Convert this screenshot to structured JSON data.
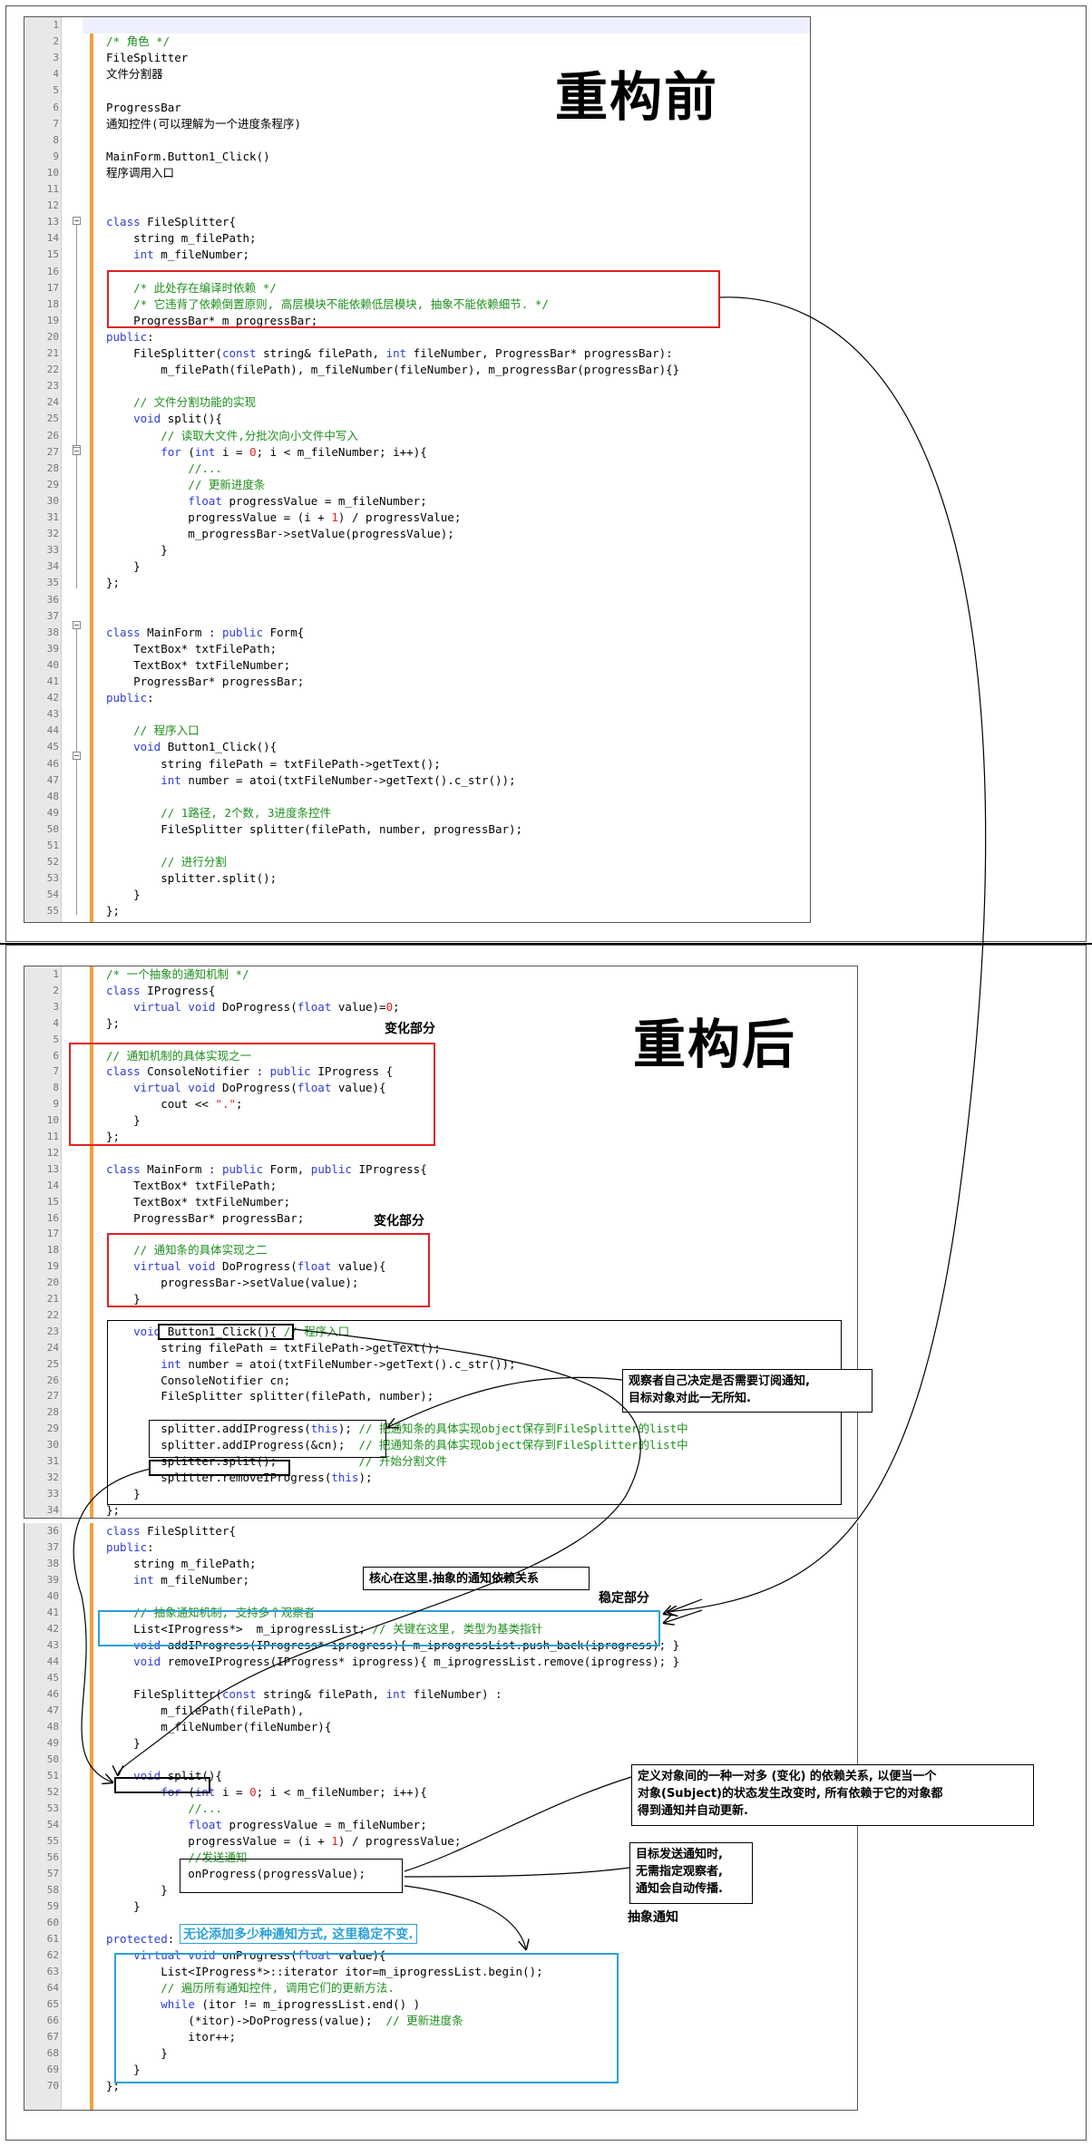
{
  "before": {
    "title": "重构前",
    "lines": [
      {
        "n": "1",
        "t": ""
      },
      {
        "n": "2",
        "t": "<span class=\"cm\">/* 角色 */</span>"
      },
      {
        "n": "3",
        "t": "FileSplitter"
      },
      {
        "n": "4",
        "t": "文件分割器"
      },
      {
        "n": "5",
        "t": ""
      },
      {
        "n": "6",
        "t": "ProgressBar"
      },
      {
        "n": "7",
        "t": "通知控件(可以理解为一个进度条程序)"
      },
      {
        "n": "8",
        "t": ""
      },
      {
        "n": "9",
        "t": "MainForm.Button1_Click()"
      },
      {
        "n": "10",
        "t": "程序调用入口"
      },
      {
        "n": "11",
        "t": ""
      },
      {
        "n": "12",
        "t": ""
      },
      {
        "n": "13",
        "t": "<span class=\"kw\">class</span> FileSplitter{"
      },
      {
        "n": "14",
        "t": "    string m_filePath;"
      },
      {
        "n": "15",
        "t": "    <span class=\"kw\">int</span> m_fileNumber;"
      },
      {
        "n": "16",
        "t": ""
      },
      {
        "n": "17",
        "t": "    <span class=\"cm\">/* 此处存在编译时依赖 */</span>"
      },
      {
        "n": "18",
        "t": "    <span class=\"cm\">/* 它违背了依赖倒置原则, 高层模块不能依赖低层模块, 抽象不能依赖细节. */</span>"
      },
      {
        "n": "19",
        "t": "    ProgressBar* m_progressBar;"
      },
      {
        "n": "20",
        "t": "<span class=\"kw\">public</span>:"
      },
      {
        "n": "21",
        "t": "    FileSplitter(<span class=\"kw\">const</span> string& filePath, <span class=\"kw\">int</span> fileNumber, ProgressBar* progressBar):"
      },
      {
        "n": "22",
        "t": "        m_filePath(filePath), m_fileNumber(fileNumber), m_progressBar(progressBar){}"
      },
      {
        "n": "23",
        "t": ""
      },
      {
        "n": "24",
        "t": "    <span class=\"cm\">// 文件分割功能的实现</span>"
      },
      {
        "n": "25",
        "t": "    <span class=\"kw\">void</span> split(){"
      },
      {
        "n": "26",
        "t": "        <span class=\"cm\">// 读取大文件,分批次向小文件中写入</span>"
      },
      {
        "n": "27",
        "t": "        <span class=\"kw\">for</span> (<span class=\"kw\">int</span> i = <span class=\"num\">0</span>; i < m_fileNumber; i++){"
      },
      {
        "n": "28",
        "t": "            <span class=\"cm\">//...</span>"
      },
      {
        "n": "29",
        "t": "            <span class=\"cm\">// 更新进度条</span>"
      },
      {
        "n": "30",
        "t": "            <span class=\"kw\">float</span> progressValue = m_fileNumber;"
      },
      {
        "n": "31",
        "t": "            progressValue = (i + <span class=\"num\">1</span>) / progressValue;"
      },
      {
        "n": "32",
        "t": "            m_progressBar->setValue(progressValue);"
      },
      {
        "n": "33",
        "t": "        }"
      },
      {
        "n": "34",
        "t": "    }"
      },
      {
        "n": "35",
        "t": "};"
      },
      {
        "n": "36",
        "t": ""
      },
      {
        "n": "37",
        "t": ""
      },
      {
        "n": "38",
        "t": "<span class=\"kw\">class</span> MainForm : <span class=\"kw\">public</span> Form{"
      },
      {
        "n": "39",
        "t": "    TextBox* txtFilePath;"
      },
      {
        "n": "40",
        "t": "    TextBox* txtFileNumber;"
      },
      {
        "n": "41",
        "t": "    ProgressBar* progressBar;"
      },
      {
        "n": "42",
        "t": "<span class=\"kw\">public</span>:"
      },
      {
        "n": "43",
        "t": ""
      },
      {
        "n": "44",
        "t": "    <span class=\"cm\">// 程序入口</span>"
      },
      {
        "n": "45",
        "t": "    <span class=\"kw\">void</span> Button1_Click(){"
      },
      {
        "n": "46",
        "t": "        string filePath = txtFilePath->getText();"
      },
      {
        "n": "47",
        "t": "        <span class=\"kw\">int</span> number = atoi(txtFileNumber->getText().c_str());"
      },
      {
        "n": "48",
        "t": ""
      },
      {
        "n": "49",
        "t": "        <span class=\"cm\">// 1路径, 2个数, 3进度条控件</span>"
      },
      {
        "n": "50",
        "t": "        FileSplitter splitter(filePath, number, progressBar);"
      },
      {
        "n": "51",
        "t": ""
      },
      {
        "n": "52",
        "t": "        <span class=\"cm\">// 进行分割</span>"
      },
      {
        "n": "53",
        "t": "        splitter.split();"
      },
      {
        "n": "54",
        "t": "    }"
      },
      {
        "n": "55",
        "t": "};"
      }
    ]
  },
  "after": {
    "title": "重构后",
    "lines1": [
      {
        "n": "1",
        "t": "<span class=\"cm\">/* 一个抽象的通知机制 */</span>"
      },
      {
        "n": "2",
        "t": "<span class=\"kw\">class</span> IProgress{"
      },
      {
        "n": "3",
        "t": "    <span class=\"kw\">virtual void</span> DoProgress(<span class=\"kw\">float</span> value)=<span class=\"num\">0</span>;"
      },
      {
        "n": "4",
        "t": "};"
      },
      {
        "n": "5",
        "t": ""
      },
      {
        "n": "6",
        "t": "<span class=\"cm\">// 通知机制的具体实现之一</span>"
      },
      {
        "n": "7",
        "t": "<span class=\"kw\">class</span> ConsoleNotifier : <span class=\"kw\">public</span> IProgress {"
      },
      {
        "n": "8",
        "t": "    <span class=\"kw\">virtual void</span> DoProgress(<span class=\"kw\">float</span> value){"
      },
      {
        "n": "9",
        "t": "        cout << <span class=\"num\">\".\"</span>;"
      },
      {
        "n": "10",
        "t": "    }"
      },
      {
        "n": "11",
        "t": "};"
      },
      {
        "n": "12",
        "t": ""
      },
      {
        "n": "13",
        "t": "<span class=\"kw\">class</span> MainForm : <span class=\"kw\">public</span> Form, <span class=\"kw\">public</span> IProgress{"
      },
      {
        "n": "14",
        "t": "    TextBox* txtFilePath;"
      },
      {
        "n": "15",
        "t": "    TextBox* txtFileNumber;"
      },
      {
        "n": "16",
        "t": "    ProgressBar* progressBar;"
      },
      {
        "n": "17",
        "t": ""
      },
      {
        "n": "18",
        "t": "    <span class=\"cm\">// 通知条的具体实现之二</span>"
      },
      {
        "n": "19",
        "t": "    <span class=\"kw\">virtual void</span> DoProgress(<span class=\"kw\">float</span> value){"
      },
      {
        "n": "20",
        "t": "        progressBar->setValue(value);"
      },
      {
        "n": "21",
        "t": "    }"
      },
      {
        "n": "22",
        "t": ""
      },
      {
        "n": "23",
        "t": "    <span class=\"kw\">void</span> Button1_Click(){ <span class=\"cm\">// 程序入口</span>"
      },
      {
        "n": "24",
        "t": "        string filePath = txtFilePath->getText();"
      },
      {
        "n": "25",
        "t": "        <span class=\"kw\">int</span> number = atoi(txtFileNumber->getText().c_str());"
      },
      {
        "n": "26",
        "t": "        ConsoleNotifier cn;"
      },
      {
        "n": "27",
        "t": "        FileSplitter splitter(filePath, number);"
      },
      {
        "n": "28",
        "t": ""
      },
      {
        "n": "29",
        "t": "        splitter.addIProgress(<span class=\"kw\">this</span>); <span class=\"cm\">// 把通知条的具体实现object保存到FileSplitter的list中</span>"
      },
      {
        "n": "30",
        "t": "        splitter.addIProgress(&cn);  <span class=\"cm\">// 把通知条的具体实现object保存到FileSplitter的list中</span>"
      },
      {
        "n": "31",
        "t": "        splitter.split();            <span class=\"cm\">// 开始分割文件</span>"
      },
      {
        "n": "32",
        "t": "        splitter.removeIProgress(<span class=\"kw\">this</span>);"
      },
      {
        "n": "33",
        "t": "    }"
      },
      {
        "n": "34",
        "t": "};"
      }
    ],
    "lines2": [
      {
        "n": "36",
        "t": "<span class=\"kw\">class</span> FileSplitter{"
      },
      {
        "n": "37",
        "t": "<span class=\"kw\">public</span>:"
      },
      {
        "n": "38",
        "t": "    string m_filePath;"
      },
      {
        "n": "39",
        "t": "    <span class=\"kw\">int</span> m_fileNumber;"
      },
      {
        "n": "40",
        "t": ""
      },
      {
        "n": "41",
        "t": "    <span class=\"cm\">// 抽象通知机制, 支持多个观察者</span>"
      },
      {
        "n": "42",
        "t": "    List&lt;IProgress*&gt;  m_iprogressList; <span class=\"cm\">// 关键在这里, 类型为基类指针</span>"
      },
      {
        "n": "43",
        "t": "    <span class=\"kw\">void</span> addIProgress(IProgress* iprogress){ m_iprogressList.push_back(iprogress); }"
      },
      {
        "n": "44",
        "t": "    <span class=\"kw\">void</span> removeIProgress(IProgress* iprogress){ m_iprogressList.remove(iprogress); }"
      },
      {
        "n": "45",
        "t": ""
      },
      {
        "n": "46",
        "t": "    FileSplitter(<span class=\"kw\">const</span> string& filePath, <span class=\"kw\">int</span> fileNumber) :"
      },
      {
        "n": "47",
        "t": "        m_filePath(filePath),"
      },
      {
        "n": "48",
        "t": "        m_fileNumber(fileNumber){"
      },
      {
        "n": "49",
        "t": "    }"
      },
      {
        "n": "50",
        "t": ""
      },
      {
        "n": "51",
        "t": "    <span class=\"kw\">void</span> split(){"
      },
      {
        "n": "52",
        "t": "        <span class=\"kw\">for</span> (<span class=\"kw\">int</span> i = <span class=\"num\">0</span>; i < m_fileNumber; i++){"
      },
      {
        "n": "53",
        "t": "            <span class=\"cm\">//...</span>"
      },
      {
        "n": "54",
        "t": "            <span class=\"kw\">float</span> progressValue = m_fileNumber;"
      },
      {
        "n": "55",
        "t": "            progressValue = (i + <span class=\"num\">1</span>) / progressValue;"
      },
      {
        "n": "56",
        "t": "            <span class=\"cm\">//发送通知</span>"
      },
      {
        "n": "57",
        "t": "            onProgress(progressValue);"
      },
      {
        "n": "58",
        "t": "        }"
      },
      {
        "n": "59",
        "t": "    }"
      },
      {
        "n": "60",
        "t": ""
      },
      {
        "n": "61",
        "t": "<span class=\"kw\">protected</span>:"
      },
      {
        "n": "62",
        "t": "    <span class=\"kw\">virtual void</span> onProgress(<span class=\"kw\">float</span> value){"
      },
      {
        "n": "63",
        "t": "        List&lt;IProgress*&gt;::iterator itor=m_iprogressList.begin();"
      },
      {
        "n": "64",
        "t": "        <span class=\"cm\">// 遍历所有通知控件, 调用它们的更新方法.</span>"
      },
      {
        "n": "65",
        "t": "        <span class=\"kw\">while</span> (itor != m_iprogressList.end() )"
      },
      {
        "n": "66",
        "t": "            (*itor)->DoProgress(value);  <span class=\"cm\">// 更新进度条</span>"
      },
      {
        "n": "67",
        "t": "            itor++;"
      },
      {
        "n": "68",
        "t": "        }"
      },
      {
        "n": "69",
        "t": "    }"
      },
      {
        "n": "70",
        "t": "};"
      }
    ],
    "labels": {
      "change1": "变化部分",
      "change2": "变化部分",
      "stable": "稳定部分",
      "abstract_notify": "抽象通知",
      "stable_note": "无论添加多少种通知方式, 这里稳定不变."
    },
    "notes": {
      "observer": "观察者自己决定是否需要订阅通知,\n目标对象对此一无所知.",
      "core": "核心在这里.抽象的通知依赖关系",
      "definition": "定义对象间的一种一对多 (变化) 的依赖关系, 以便当一个\n对象(Subject)的状态发生改变时, 所有依赖于它的对象都\n得到通知并自动更新.",
      "target": "目标发送通知时,\n无需指定观察者,\n通知会自动传播."
    }
  }
}
